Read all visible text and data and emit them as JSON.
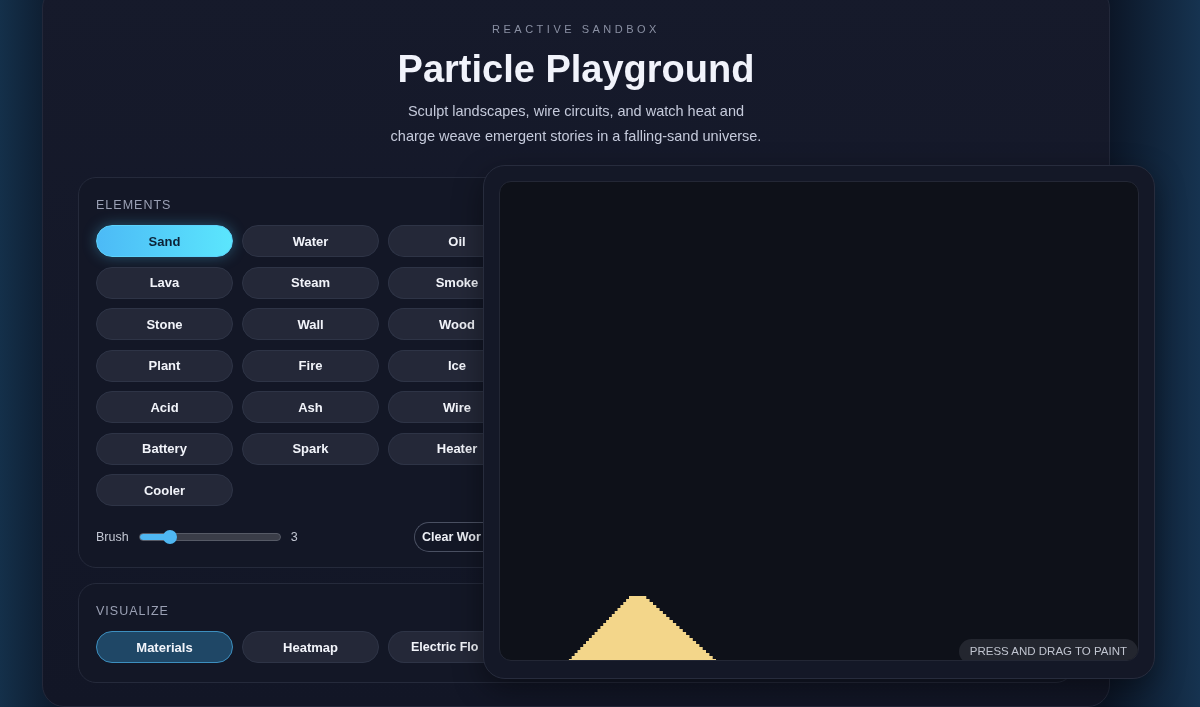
{
  "header": {
    "eyebrow": "REACTIVE SANDBOX",
    "title": "Particle Playground",
    "subtitle": "Sculpt landscapes, wire circuits, and watch heat and charge weave emergent stories in a falling-sand universe."
  },
  "elements_panel": {
    "heading": "ELEMENTS",
    "elements": [
      {
        "label": "Sand",
        "selected": true
      },
      {
        "label": "Water",
        "selected": false
      },
      {
        "label": "Oil",
        "selected": false
      },
      {
        "label": "Lava",
        "selected": false
      },
      {
        "label": "Steam",
        "selected": false
      },
      {
        "label": "Smoke",
        "selected": false
      },
      {
        "label": "Stone",
        "selected": false
      },
      {
        "label": "Wall",
        "selected": false
      },
      {
        "label": "Wood",
        "selected": false
      },
      {
        "label": "Plant",
        "selected": false
      },
      {
        "label": "Fire",
        "selected": false
      },
      {
        "label": "Ice",
        "selected": false
      },
      {
        "label": "Acid",
        "selected": false
      },
      {
        "label": "Ash",
        "selected": false
      },
      {
        "label": "Wire",
        "selected": false
      },
      {
        "label": "Battery",
        "selected": false
      },
      {
        "label": "Spark",
        "selected": false
      },
      {
        "label": "Heater",
        "selected": false
      },
      {
        "label": "Cooler",
        "selected": false
      }
    ],
    "brush": {
      "label": "Brush",
      "level": 0.22,
      "reading": "3"
    },
    "clear_button": "Clear Wor"
  },
  "visualize_panel": {
    "heading": "VISUALIZE",
    "modes": [
      {
        "label": "Materials",
        "selected": true
      },
      {
        "label": "Heatmap",
        "selected": false
      },
      {
        "label": "Electric Flo",
        "selected": false
      }
    ]
  },
  "canvas": {
    "hint": "PRESS AND DRAG TO PAINT"
  }
}
